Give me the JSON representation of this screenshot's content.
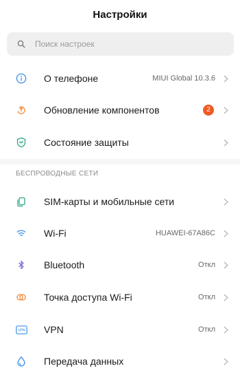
{
  "header": {
    "title": "Настройки"
  },
  "search": {
    "placeholder": "Поиск настроек"
  },
  "colors": {
    "accent_orange": "#f15a24",
    "badge": "#f15a24"
  },
  "top_items": [
    {
      "label": "О телефоне",
      "value": "MIUI Global 10.3.6",
      "icon": "info-icon"
    },
    {
      "label": "Обновление компонентов",
      "badge": "2",
      "icon": "update-icon"
    },
    {
      "label": "Состояние защиты",
      "icon": "shield-icon"
    }
  ],
  "wireless": {
    "section_title": "БЕСПРОВОДНЫЕ СЕТИ",
    "items": [
      {
        "label": "SIM-карты и мобильные сети",
        "icon": "sim-icon"
      },
      {
        "label": "Wi-Fi",
        "value": "HUAWEI-67A86C",
        "icon": "wifi-icon"
      },
      {
        "label": "Bluetooth",
        "value": "Откл",
        "icon": "bluetooth-icon"
      },
      {
        "label": "Точка доступа Wi-Fi",
        "value": "Откл",
        "icon": "hotspot-icon"
      },
      {
        "label": "VPN",
        "value": "Откл",
        "icon": "vpn-icon",
        "icon_text": "VPN"
      },
      {
        "label": "Передача данных",
        "icon": "data-usage-icon"
      }
    ]
  }
}
